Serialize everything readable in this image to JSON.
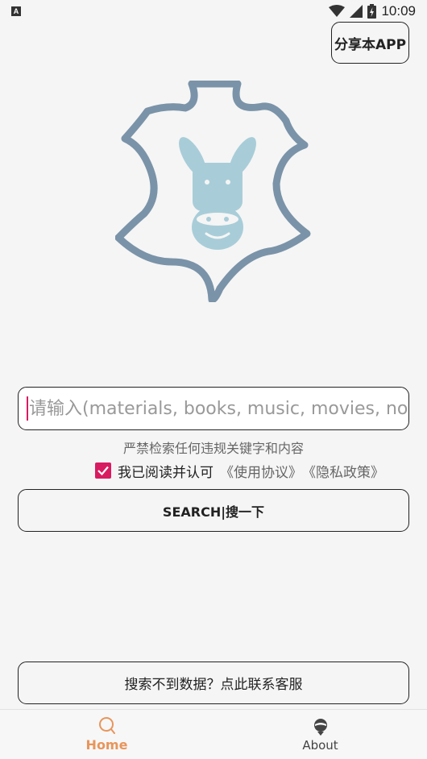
{
  "status_bar": {
    "time": "10:09",
    "left_icon": "A"
  },
  "header": {
    "share_label": "分享本APP"
  },
  "logo": {
    "icon": "donkey-leather-logo",
    "outline_color": "#7a93a8",
    "donkey_color": "#a8cdd8"
  },
  "search": {
    "placeholder": "请输入(materials, books, music, movies, novel",
    "value": ""
  },
  "notice": {
    "warning": "严禁检索任何违规关键字和内容",
    "agree_text": "我已阅读并认可",
    "terms_link": "《使用协议》",
    "privacy_link": "《隐私政策》",
    "checked": true
  },
  "actions": {
    "search_label": "SEARCH|搜一下",
    "contact_label": "搜索不到数据？点此联系客服"
  },
  "nav": {
    "items": [
      {
        "label": "Home",
        "icon": "search-icon",
        "active": true
      },
      {
        "label": "About",
        "icon": "about-icon",
        "active": false
      }
    ]
  },
  "colors": {
    "accent": "#d81b60",
    "nav_active": "#e8955a",
    "background": "#f5f5f5"
  }
}
